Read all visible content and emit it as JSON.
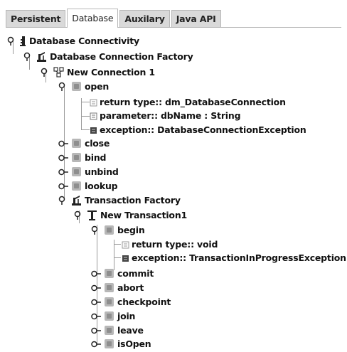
{
  "tabs": [
    {
      "label": "Persistent",
      "active": false
    },
    {
      "label": "Database",
      "active": true
    },
    {
      "label": "Auxilary",
      "active": false
    },
    {
      "label": "Java API",
      "active": false
    }
  ],
  "tree": {
    "root": "Database Connectivity",
    "factory": "Database Connection Factory",
    "connection": "New Connection 1",
    "open": {
      "label": "open",
      "details": [
        "return type:: dm_DatabaseConnection",
        "parameter:: dbName : String",
        "exception:: DatabaseConnectionException"
      ]
    },
    "methods": [
      "close",
      "bind",
      "unbind",
      "lookup"
    ],
    "transaction_factory": "Transaction Factory",
    "transaction": "New Transaction1",
    "begin": {
      "label": "begin",
      "details": [
        "return type:: void",
        "exception:: TransactionInProgressException"
      ]
    },
    "transaction_methods": [
      "commit",
      "abort",
      "checkpoint",
      "join",
      "leave",
      "isOpen"
    ]
  },
  "icons": {
    "expanded": "expanded-toggle-icon",
    "collapsed": "collapsed-toggle-icon",
    "method": "method-icon",
    "factory": "factory-icon",
    "connection": "connection-icon",
    "transaction": "transaction-icon",
    "database": "database-icon",
    "detail": "detail-icon"
  },
  "colors": {
    "tab_bg": "#d9d9d9",
    "active_tab_bg": "#ffffff",
    "method_icon": "#b7b7b7",
    "text": "#111111"
  }
}
